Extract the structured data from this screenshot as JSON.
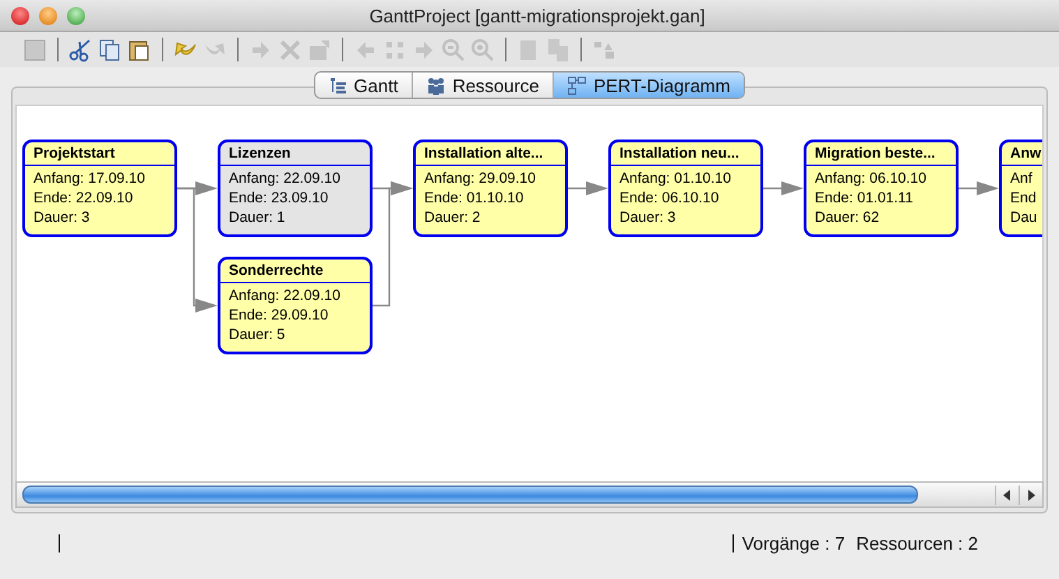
{
  "window": {
    "title": "GanttProject [gantt-migrationsprojekt.gan]"
  },
  "tabs": [
    {
      "label": "Gantt",
      "selected": false,
      "kind": "gantt"
    },
    {
      "label": "Ressource",
      "selected": false,
      "kind": "resource"
    },
    {
      "label": "PERT-Diagramm",
      "selected": true,
      "kind": "pert"
    }
  ],
  "pert": {
    "columns": [
      [
        {
          "title": "Projektstart",
          "lines": [
            "Anfang: 17.09.10",
            "Ende: 22.09.10",
            "Dauer: 3"
          ],
          "selected": false
        }
      ],
      [
        {
          "title": "Lizenzen",
          "lines": [
            "Anfang: 22.09.10",
            "Ende: 23.09.10",
            "Dauer: 1"
          ],
          "selected": true
        },
        {
          "title": "Sonderrechte",
          "lines": [
            "Anfang: 22.09.10",
            "Ende: 29.09.10",
            "Dauer: 5"
          ],
          "selected": false
        }
      ],
      [
        {
          "title": "Installation alte...",
          "lines": [
            "Anfang: 29.09.10",
            "Ende: 01.10.10",
            "Dauer: 2"
          ],
          "selected": false
        }
      ],
      [
        {
          "title": "Installation neu...",
          "lines": [
            "Anfang: 01.10.10",
            "Ende: 06.10.10",
            "Dauer: 3"
          ],
          "selected": false
        }
      ],
      [
        {
          "title": "Migration beste...",
          "lines": [
            "Anfang: 06.10.10",
            "Ende: 01.01.11",
            "Dauer: 62"
          ],
          "selected": false
        }
      ],
      [
        {
          "title": "Anw",
          "lines": [
            "Anf",
            "End",
            "Dau"
          ],
          "selected": false
        }
      ]
    ]
  },
  "status_bar": {
    "tasks": "Vorgänge : 7",
    "resources": "Ressourcen : 2"
  }
}
